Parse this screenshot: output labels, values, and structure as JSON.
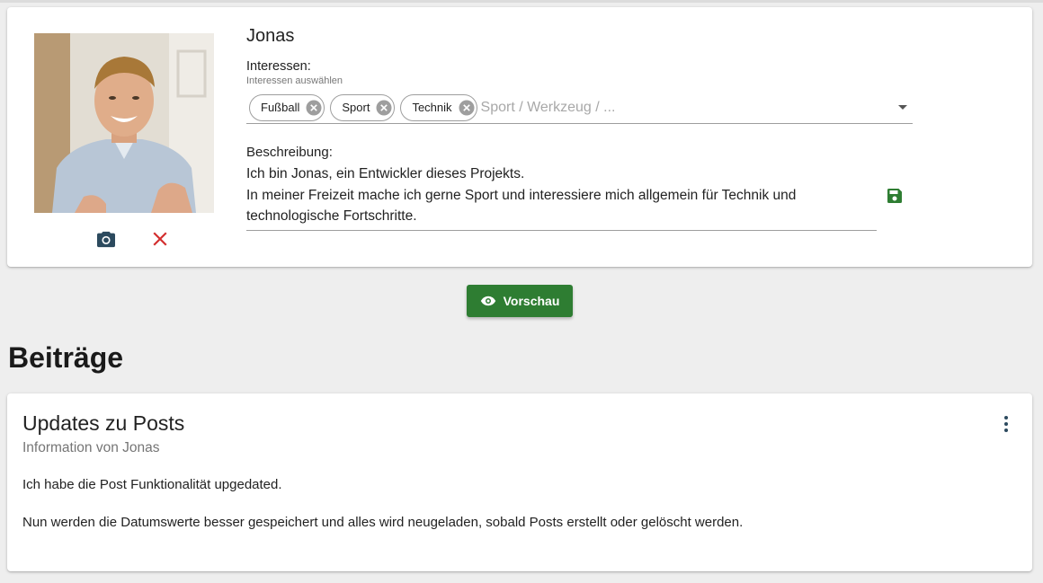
{
  "profile": {
    "name": "Jonas",
    "interests": {
      "label": "Interessen:",
      "hint": "Interessen auswählen",
      "chips": [
        "Fußball",
        "Sport",
        "Technik"
      ],
      "placeholder": "Sport / Werkzeug / ..."
    },
    "description": {
      "label": "Beschreibung:",
      "lines": [
        "Ich bin Jonas, ein Entwickler dieses Projekts.",
        "In meiner Freizeit mache ich gerne Sport und interessiere mich allgemein für Technik und",
        "technologische Fortschritte."
      ]
    },
    "icons": {
      "camera": "camera-icon",
      "remove": "close-icon",
      "save": "save-icon",
      "chip_remove": "cancel-circle-icon",
      "dropdown": "arrow-drop-down-icon"
    }
  },
  "preview_button": {
    "label": "Vorschau",
    "icon": "eye-icon"
  },
  "section": {
    "title": "Beiträge"
  },
  "posts": [
    {
      "title": "Updates zu Posts",
      "subtitle": "Information von Jonas",
      "paragraphs": [
        "Ich habe die Post Funktionalität upgedated.",
        "Nun werden die Datumswerte besser gespeichert und alles wird neugeladen, sobald Posts erstellt oder gelöscht werden."
      ],
      "menu_icon": "more-vert-icon"
    }
  ],
  "colors": {
    "primary_green": "#2e7d32",
    "icon_blue": "#2c4a5e",
    "danger_red": "#d32f2f",
    "background": "#eeeeee"
  }
}
